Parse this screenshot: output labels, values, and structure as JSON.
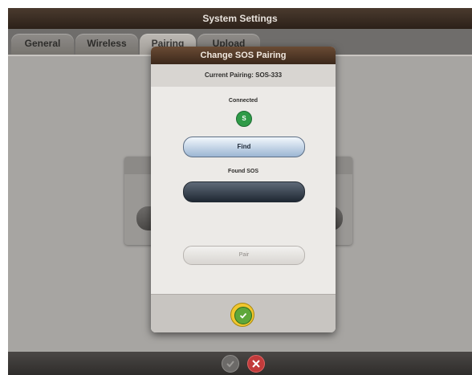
{
  "window": {
    "title": "System Settings"
  },
  "tabs": [
    {
      "label": "General"
    },
    {
      "label": "Wireless"
    },
    {
      "label": "Pairing"
    },
    {
      "label": "Upload"
    }
  ],
  "active_tab": "Pairing",
  "modal": {
    "title": "Change SOS Pairing",
    "current_pairing_label": "Current Pairing:",
    "current_pairing_value": "SOS-333",
    "connected_label": "Connected",
    "status_badge": "S",
    "find_label": "Find",
    "found_label": "Found SOS",
    "pair_label": "Pair"
  },
  "colors": {
    "status_connected": "#2f9b48",
    "ok_ring": "#f0c62e",
    "cancel": "#c23b3b"
  },
  "icons": {
    "ok": "check-icon",
    "cancel": "close-icon",
    "confirm": "check-icon"
  }
}
